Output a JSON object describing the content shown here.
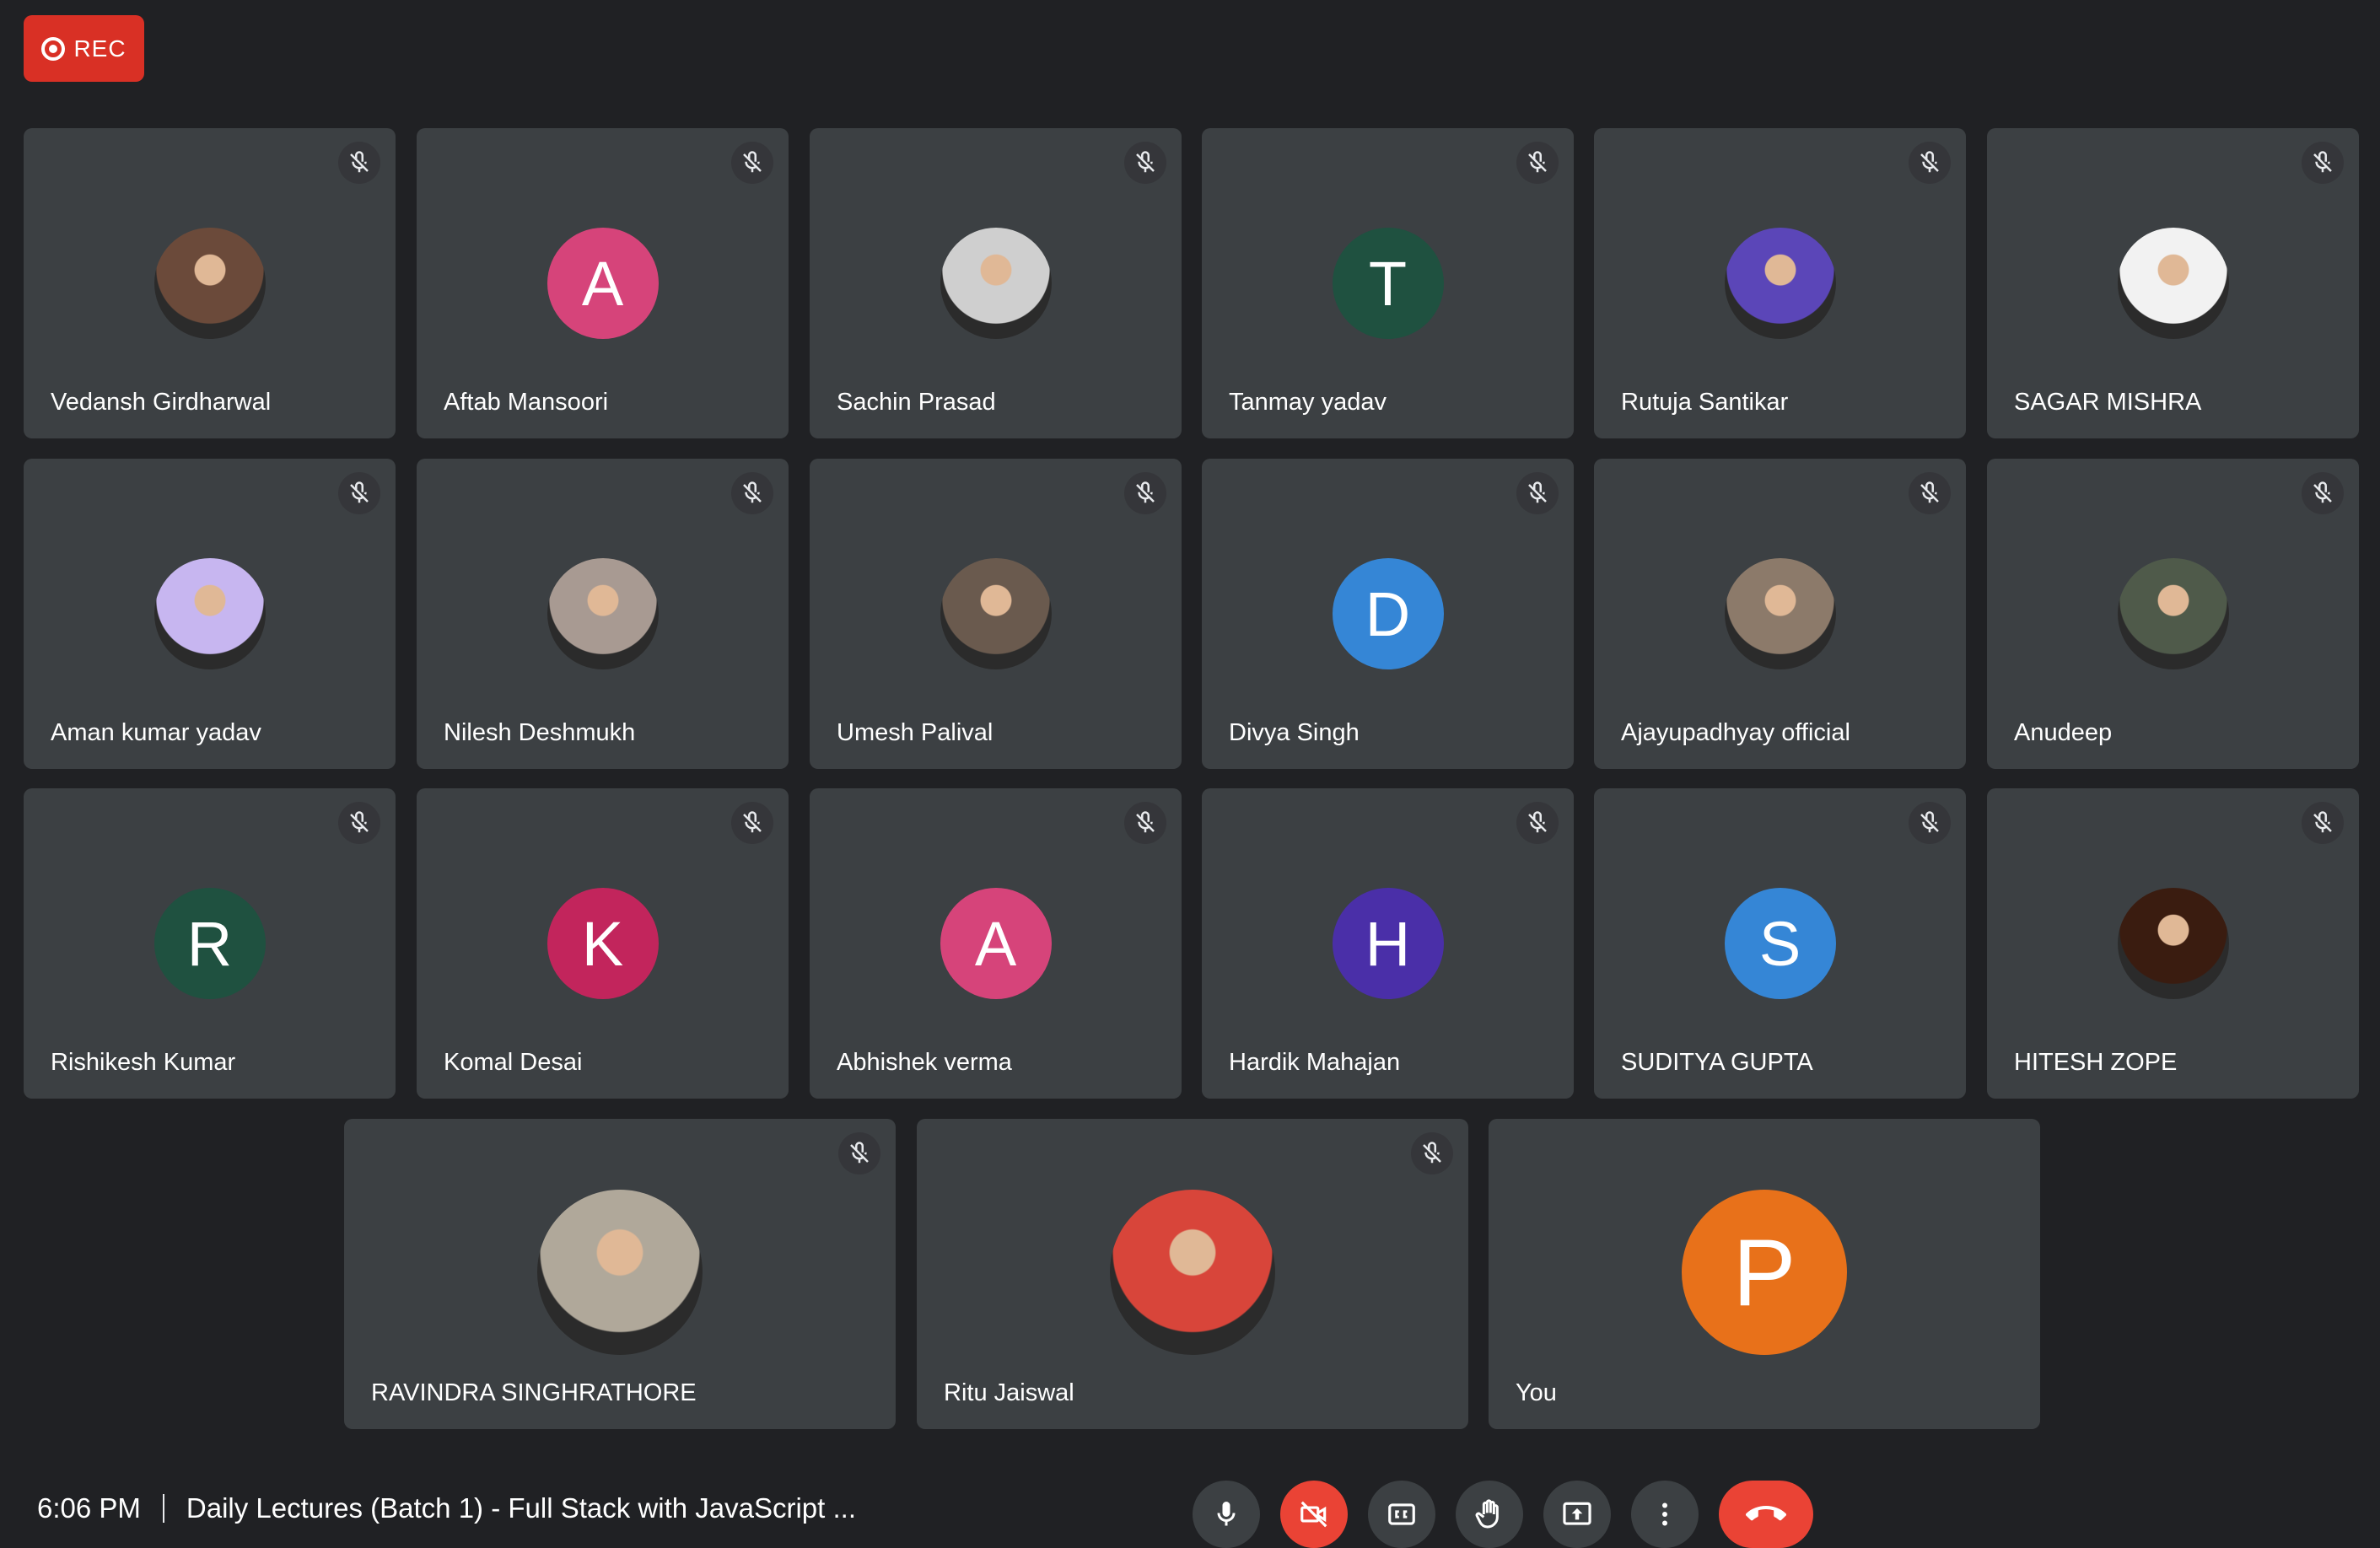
{
  "recording": {
    "label": "REC"
  },
  "participants": [
    {
      "name": "Vedansh Girdharwal",
      "initial": "",
      "avatar_color": "#6b4a3a",
      "photo": true
    },
    {
      "name": "Aftab Mansoori",
      "initial": "A",
      "avatar_color": "#d6447a",
      "photo": false
    },
    {
      "name": "Sachin Prasad",
      "initial": "",
      "avatar_color": "#cfcfcf",
      "photo": true
    },
    {
      "name": "Tanmay yadav",
      "initial": "T",
      "avatar_color": "#1f5140",
      "photo": false
    },
    {
      "name": "Rutuja Santikar",
      "initial": "",
      "avatar_color": "#5b46b8",
      "photo": true
    },
    {
      "name": "SAGAR MISHRA",
      "initial": "",
      "avatar_color": "#f2f2f2",
      "photo": true
    },
    {
      "name": "Aman kumar yadav",
      "initial": "",
      "avatar_color": "#c7b6f0",
      "photo": true
    },
    {
      "name": "Nilesh Deshmukh",
      "initial": "",
      "avatar_color": "#a89a92",
      "photo": true
    },
    {
      "name": "Umesh Palival",
      "initial": "",
      "avatar_color": "#6a5a4e",
      "photo": true
    },
    {
      "name": "Divya Singh",
      "initial": "D",
      "avatar_color": "#3586d6",
      "photo": false
    },
    {
      "name": "Ajayupadhyay official",
      "initial": "",
      "avatar_color": "#8c7a6a",
      "photo": true
    },
    {
      "name": "Anudeep",
      "initial": "",
      "avatar_color": "#4f5a4a",
      "photo": true
    },
    {
      "name": "Rishikesh Kumar",
      "initial": "R",
      "avatar_color": "#1f5140",
      "photo": false
    },
    {
      "name": "Komal Desai",
      "initial": "K",
      "avatar_color": "#c2255c",
      "photo": false
    },
    {
      "name": "Abhishek verma",
      "initial": "A",
      "avatar_color": "#d6447a",
      "photo": false
    },
    {
      "name": "Hardik Mahajan",
      "initial": "H",
      "avatar_color": "#4a2fa8",
      "photo": false
    },
    {
      "name": "SUDITYA GUPTA",
      "initial": "S",
      "avatar_color": "#3586d6",
      "photo": false
    },
    {
      "name": "HITESH ZOPE",
      "initial": "",
      "avatar_color": "#3a1c10",
      "photo": true
    },
    {
      "name": "RAVINDRA SINGHRATHORE",
      "initial": "",
      "avatar_color": "#b0a89a",
      "photo": true
    },
    {
      "name": "Ritu Jaiswal",
      "initial": "",
      "avatar_color": "#d8453a",
      "photo": true
    },
    {
      "name": "You",
      "initial": "P",
      "avatar_color": "#e8711a",
      "photo": false
    }
  ],
  "footer": {
    "time": "6:06 PM",
    "meeting_title": "Daily Lectures (Batch 1) - Full Stack with JavaScript ..."
  },
  "controls": {
    "mic": "microphone-icon",
    "camera": "camera-off-icon",
    "captions": "captions-icon",
    "raise_hand": "raise-hand-icon",
    "present": "present-screen-icon",
    "more": "more-options-icon",
    "leave": "leave-call-icon"
  }
}
